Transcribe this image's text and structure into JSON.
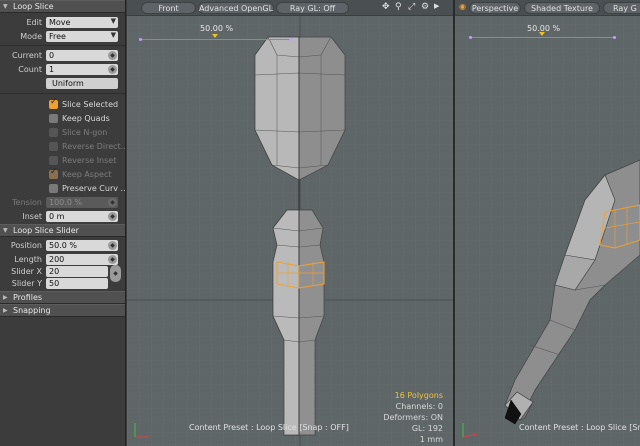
{
  "panel": {
    "loop_slice": {
      "title": "Loop Slice",
      "edit": {
        "label": "Edit",
        "value": "Move"
      },
      "mode": {
        "label": "Mode",
        "value": "Free"
      },
      "current": {
        "label": "Current",
        "value": "0"
      },
      "count": {
        "label": "Count",
        "value": "1"
      },
      "uniform_label": "Uniform",
      "checkboxes": [
        {
          "label": "Slice Selected",
          "checked": true,
          "enabled": true
        },
        {
          "label": "Keep Quads",
          "checked": false,
          "enabled": true
        },
        {
          "label": "Slice N-gon",
          "checked": false,
          "enabled": false
        },
        {
          "label": "Reverse Direct...",
          "checked": false,
          "enabled": false
        },
        {
          "label": "Reverse Inset",
          "checked": false,
          "enabled": false
        },
        {
          "label": "Keep Aspect",
          "checked": true,
          "enabled": false
        },
        {
          "label": "Preserve Curv ...",
          "checked": false,
          "enabled": true
        }
      ],
      "tension": {
        "label": "Tension",
        "value": "100.0 %"
      },
      "inset": {
        "label": "Inset",
        "value": "0 m"
      }
    },
    "loop_slice_slider": {
      "title": "Loop Slice Slider",
      "position": {
        "label": "Position",
        "value": "50.0 %"
      },
      "length": {
        "label": "Length",
        "value": "200"
      },
      "slider_x": {
        "label": "Slider X",
        "value": "20"
      },
      "slider_y": {
        "label": "Slider Y",
        "value": "50"
      }
    },
    "profiles": {
      "title": "Profiles"
    },
    "snapping": {
      "title": "Snapping"
    }
  },
  "viewport_front": {
    "view_label": "Front",
    "shading_label": "Advanced OpenGL",
    "raygl_label": "Ray GL: Off",
    "slider_percent": "50.00 %",
    "status": "Content Preset : Loop Slice  [Snap : OFF]",
    "info": {
      "polygons": "16 Polygons",
      "channels": "Channels: 0",
      "deformers": "Deformers: ON",
      "gl": "GL: 192",
      "unit": "1 mm"
    }
  },
  "viewport_persp": {
    "view_label": "Perspective",
    "shading_label": "Shaded Texture",
    "raygl_label": "Ray G",
    "slider_percent": "50.00 %",
    "status": "Content Preset : Loop Slice  [Snap"
  },
  "colors": {
    "accent_orange": "#f0a030",
    "slider_purple": "#a070e0",
    "polygon_count": "#f0c040"
  }
}
